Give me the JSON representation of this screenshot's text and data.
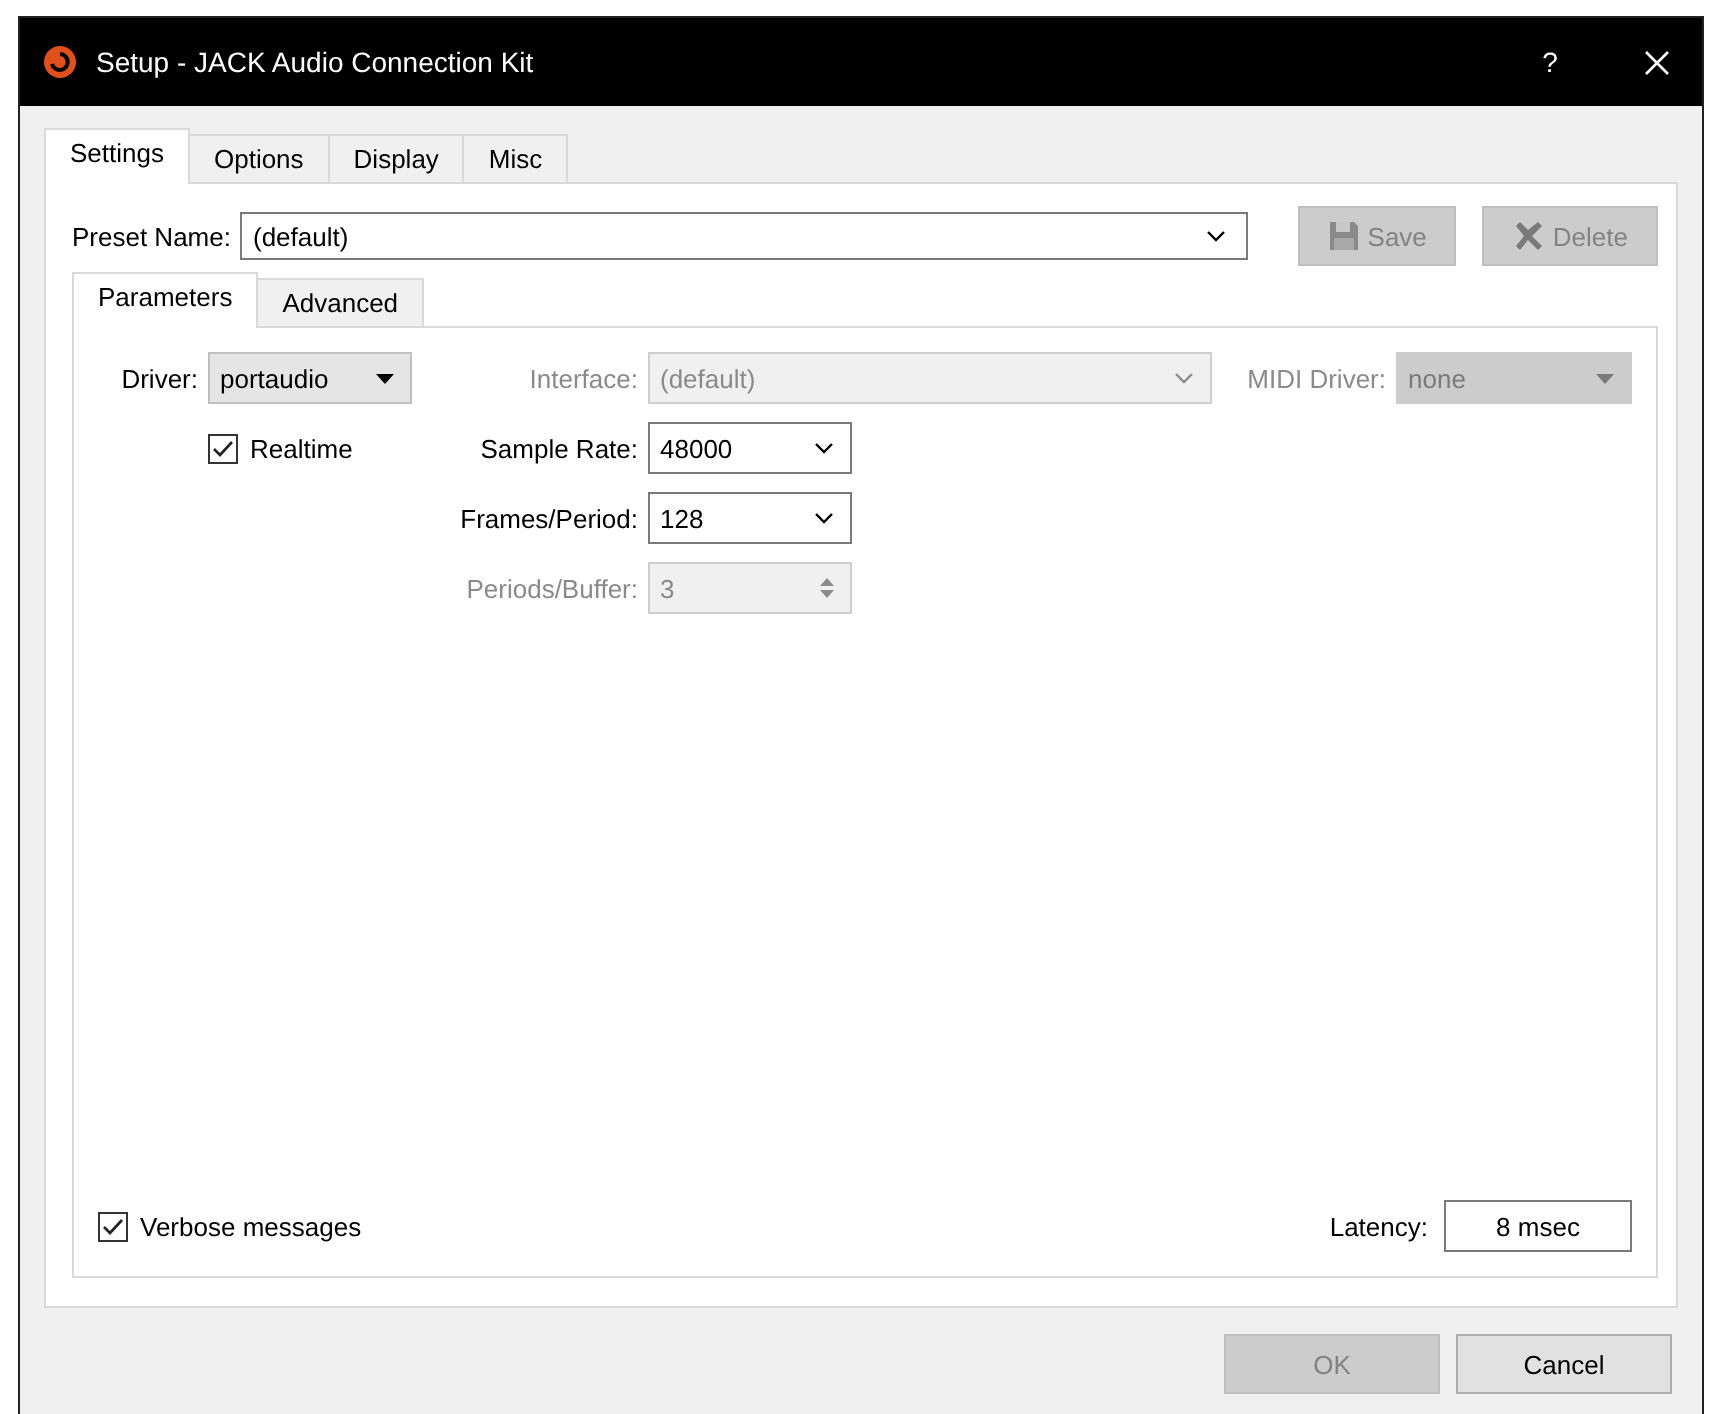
{
  "window": {
    "title": "Setup - JACK Audio Connection Kit",
    "help": "?"
  },
  "tabs": [
    {
      "label": "Settings",
      "selected": true
    },
    {
      "label": "Options",
      "selected": false
    },
    {
      "label": "Display",
      "selected": false
    },
    {
      "label": "Misc",
      "selected": false
    }
  ],
  "preset": {
    "label": "Preset Name:",
    "value": "(default)",
    "save": {
      "label": "Save",
      "disabled": true
    },
    "delete": {
      "label": "Delete",
      "disabled": true
    }
  },
  "subtabs": [
    {
      "label": "Parameters",
      "selected": true
    },
    {
      "label": "Advanced",
      "selected": false
    }
  ],
  "parameters": {
    "driver": {
      "label": "Driver:",
      "value": "portaudio"
    },
    "interface": {
      "label": "Interface:",
      "value": "(default)",
      "disabled": true
    },
    "midi_driver": {
      "label": "MIDI Driver:",
      "value": "none",
      "disabled": true
    },
    "realtime": {
      "label": "Realtime",
      "checked": true
    },
    "sample_rate": {
      "label": "Sample Rate:",
      "value": "48000",
      "disabled": false
    },
    "frames_period": {
      "label": "Frames/Period:",
      "value": "128",
      "disabled": false
    },
    "periods_buffer": {
      "label": "Periods/Buffer:",
      "value": "3",
      "disabled": true
    }
  },
  "verbose": {
    "label": "Verbose messages",
    "checked": true
  },
  "latency": {
    "label": "Latency:",
    "value": "8 msec"
  },
  "buttons": [
    {
      "label": "OK",
      "disabled": true
    },
    {
      "label": "Cancel",
      "disabled": false
    }
  ]
}
